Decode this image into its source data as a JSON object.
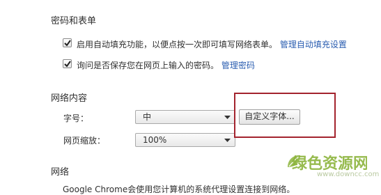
{
  "sections": {
    "passwords": {
      "title": "密码和表单",
      "autofill": {
        "label": "启用自动填充功能，以便点按一次即可填写网络表单。",
        "link": "管理自动填充设置",
        "checked": true
      },
      "save_passwords": {
        "label": "询问是否保存您在网页上输入的密码。",
        "link": "管理密码",
        "checked": true
      }
    },
    "web_content": {
      "title": "网络内容",
      "font_size": {
        "label": "字号：",
        "value": "中"
      },
      "customize_fonts_button": "自定义字体...",
      "page_zoom": {
        "label": "网页缩放：",
        "value": "100%"
      }
    },
    "network": {
      "title": "网络",
      "desc": "Google Chrome会使用您计算机的系统代理设置连接到网络。"
    }
  },
  "watermark": {
    "logo_text": "绿色资源网",
    "url": "www.downcc.com",
    "color": "#8cb43c"
  },
  "colors": {
    "link": "#2a5db0",
    "highlight_box": "#a3232d"
  }
}
